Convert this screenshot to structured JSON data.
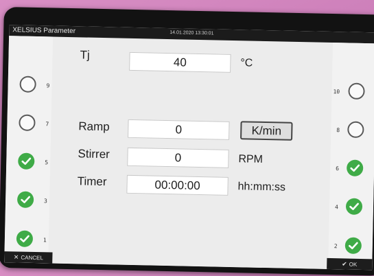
{
  "titlebar": {
    "app_title": "XELSIUS Parameter",
    "datetime": "14.01.2020 13:30:01"
  },
  "left_slots": [
    {
      "number": "9",
      "checked": false
    },
    {
      "number": "7",
      "checked": false
    },
    {
      "number": "5",
      "checked": true
    },
    {
      "number": "3",
      "checked": true
    },
    {
      "number": "1",
      "checked": true
    }
  ],
  "right_slots": [
    {
      "number": "10",
      "checked": false
    },
    {
      "number": "8",
      "checked": false
    },
    {
      "number": "6",
      "checked": true
    },
    {
      "number": "4",
      "checked": true
    },
    {
      "number": "2",
      "checked": true
    }
  ],
  "params": {
    "tj": {
      "label": "Tj",
      "value": "40",
      "unit": "°C"
    },
    "ramp": {
      "label": "Ramp",
      "value": "0",
      "unit": "K/min"
    },
    "stirrer": {
      "label": "Stirrer",
      "value": "0",
      "unit": "RPM"
    },
    "timer": {
      "label": "Timer",
      "value": "00:00:00",
      "unit": "hh:mm:ss"
    }
  },
  "buttons": {
    "cancel": "CANCEL",
    "ok": "OK"
  },
  "colors": {
    "check_green": "#3fab47",
    "titlebar": "#1b1b1b"
  }
}
